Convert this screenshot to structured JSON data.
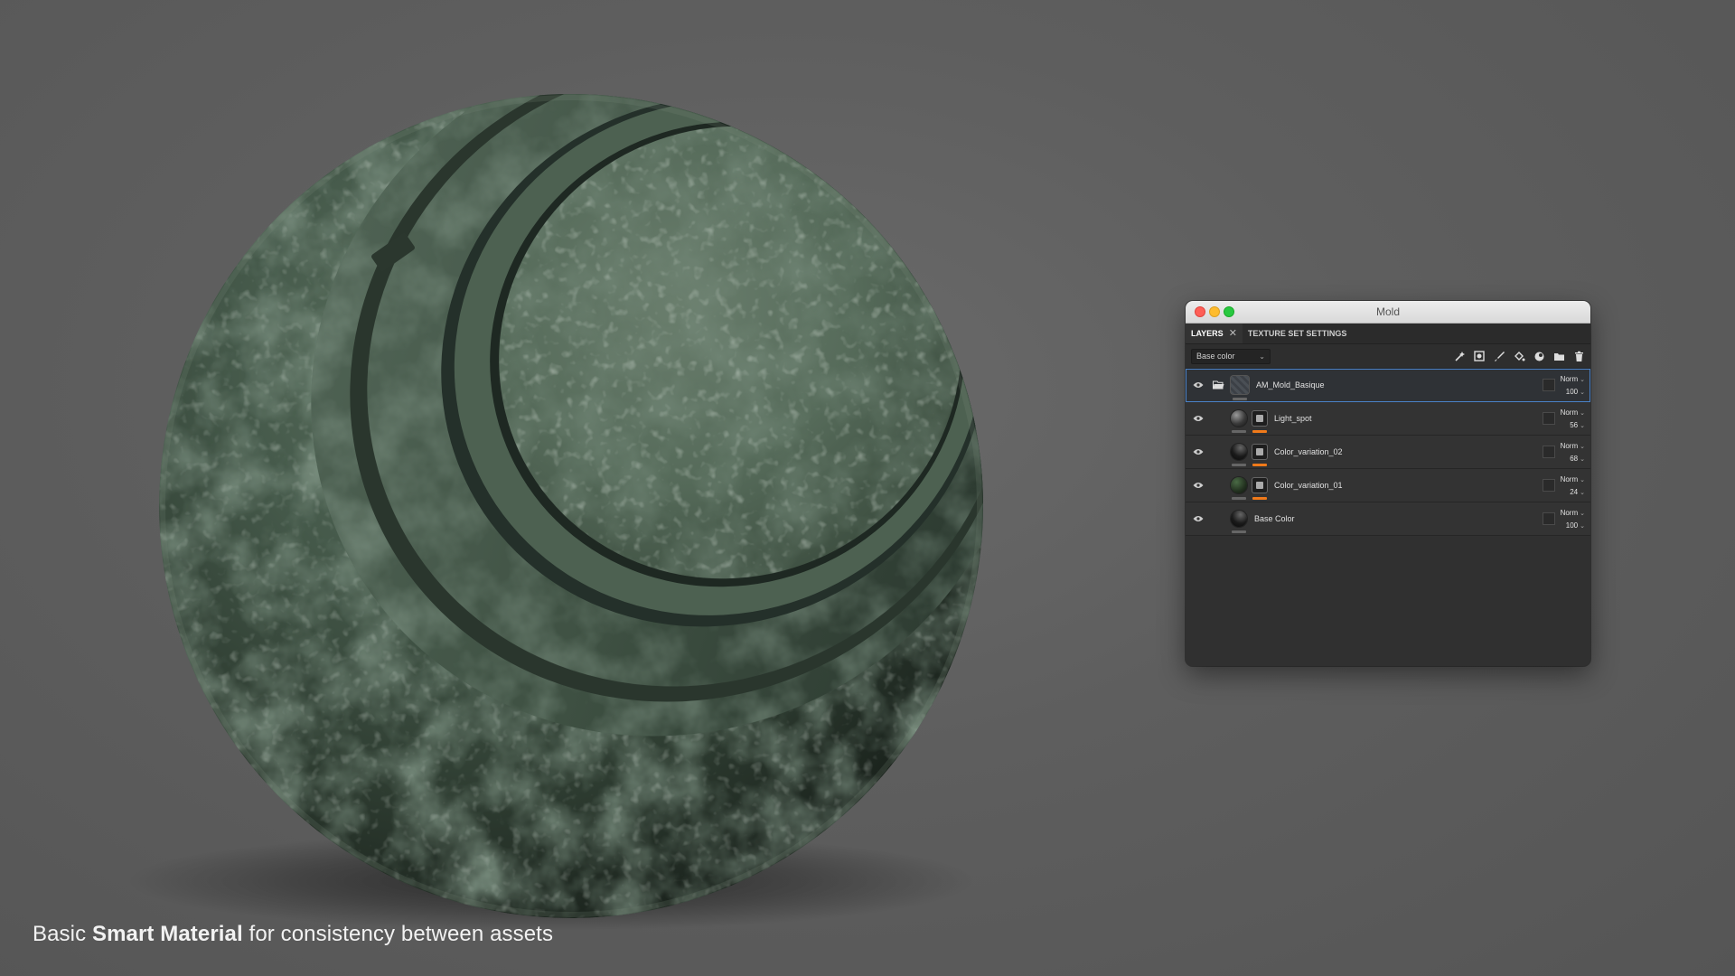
{
  "caption": {
    "prefix": "Basic ",
    "bold": "Smart Material",
    "suffix": " for consistency between assets"
  },
  "colors": {
    "background": "#5e5e5e",
    "material_base": "#3e5340",
    "selection_outline": "#4a82c8",
    "mask_bar": "#f07a1a"
  },
  "window": {
    "title": "Mold",
    "tabs": [
      {
        "label": "LAYERS",
        "active": true,
        "closable": true
      },
      {
        "label": "TEXTURE SET SETTINGS",
        "active": false
      }
    ],
    "channel_select": "Base color",
    "toolbar_icons": [
      "add-effect-icon",
      "add-mask-icon",
      "add-paint-layer-icon",
      "add-fill-layer-icon",
      "smart-material-icon",
      "add-folder-icon",
      "delete-icon"
    ],
    "layers": [
      {
        "name": "AM_Mold_Basique",
        "type": "folder",
        "blend": "Norm",
        "opacity": "100",
        "has_mask": false,
        "selected": true
      },
      {
        "name": "Light_spot",
        "type": "fill",
        "blend": "Norm",
        "opacity": "56",
        "has_mask": true,
        "selected": false
      },
      {
        "name": "Color_variation_02",
        "type": "fill",
        "blend": "Norm",
        "opacity": "68",
        "has_mask": true,
        "selected": false
      },
      {
        "name": "Color_variation_01",
        "type": "fill",
        "blend": "Norm",
        "opacity": "24",
        "has_mask": true,
        "selected": false
      },
      {
        "name": "Base Color",
        "type": "fill",
        "blend": "Norm",
        "opacity": "100",
        "has_mask": false,
        "selected": false
      }
    ]
  }
}
